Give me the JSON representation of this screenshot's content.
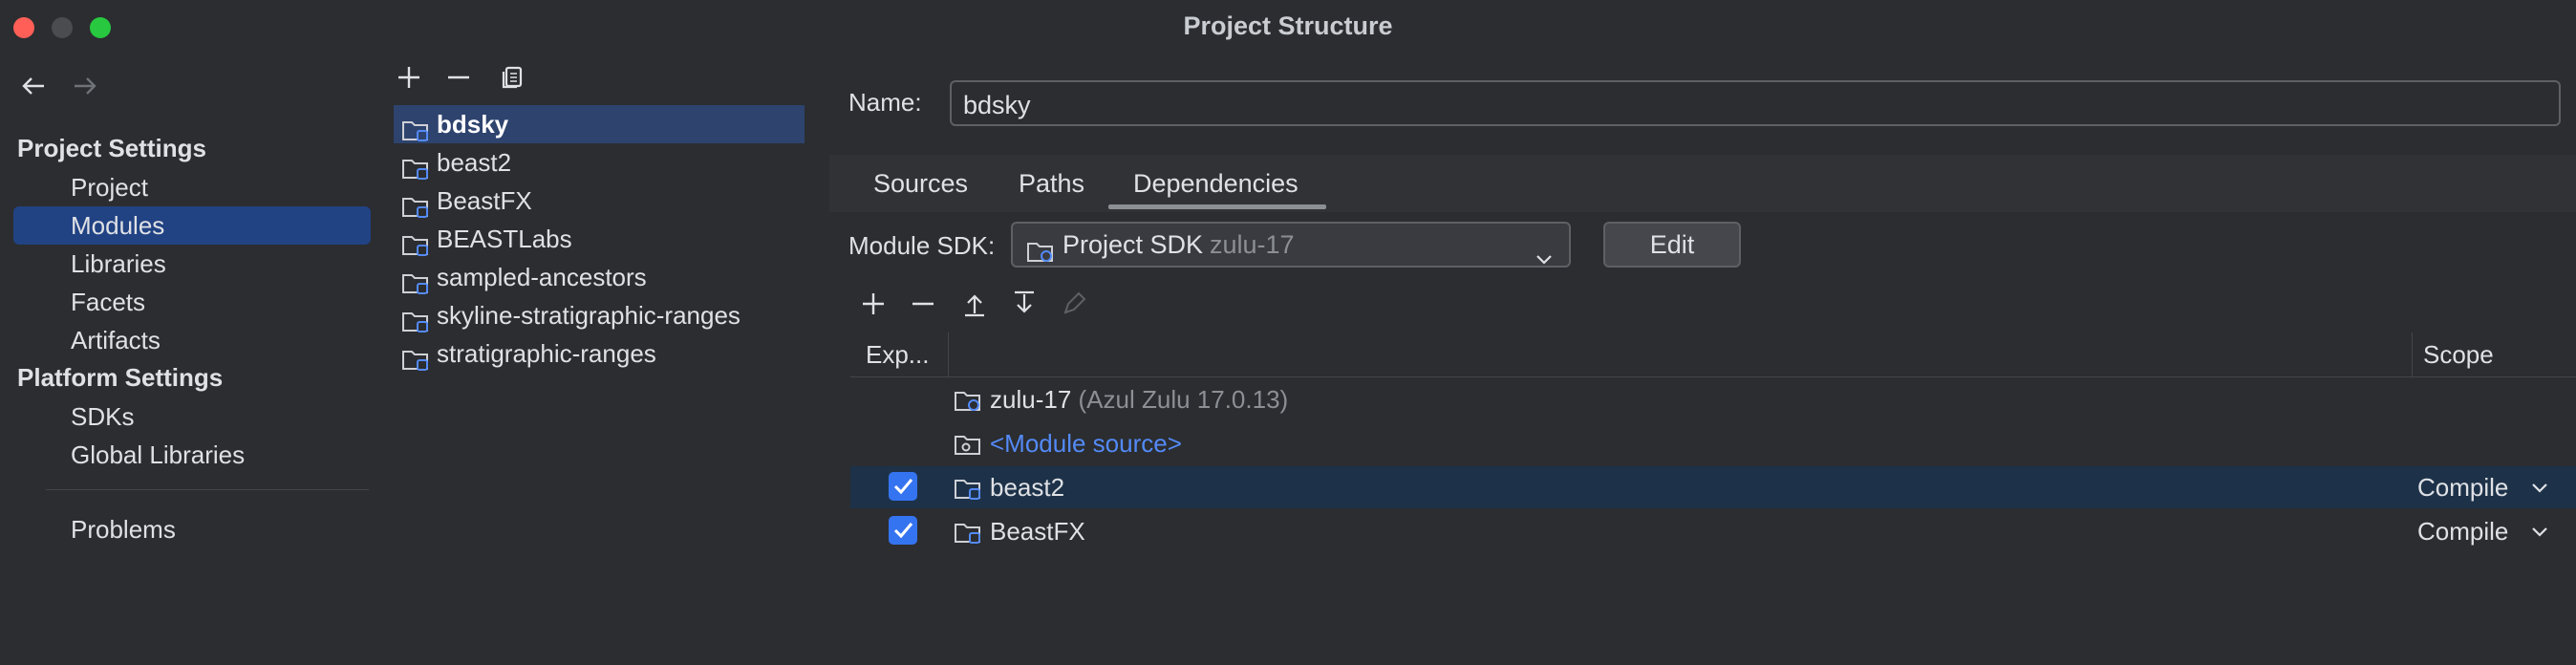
{
  "window": {
    "title": "Project Structure"
  },
  "nav": {
    "back_icon": "arrow-left-icon",
    "forward_icon": "arrow-right-icon"
  },
  "sidebar": {
    "project_settings_heading": "Project Settings",
    "project_settings_items": [
      {
        "label": "Project",
        "selected": false
      },
      {
        "label": "Modules",
        "selected": true
      },
      {
        "label": "Libraries",
        "selected": false
      },
      {
        "label": "Facets",
        "selected": false
      },
      {
        "label": "Artifacts",
        "selected": false
      }
    ],
    "platform_settings_heading": "Platform Settings",
    "platform_settings_items": [
      {
        "label": "SDKs"
      },
      {
        "label": "Global Libraries"
      }
    ],
    "problems_label": "Problems"
  },
  "module_list": {
    "toolbar": {
      "add_icon": "plus-icon",
      "remove_icon": "minus-icon",
      "copy_icon": "copy-icon"
    },
    "items": [
      {
        "label": "bdsky",
        "selected": true
      },
      {
        "label": "beast2",
        "selected": false
      },
      {
        "label": "BeastFX",
        "selected": false
      },
      {
        "label": "BEASTLabs",
        "selected": false
      },
      {
        "label": "sampled-ancestors",
        "selected": false
      },
      {
        "label": "skyline-stratigraphic-ranges",
        "selected": false
      },
      {
        "label": "stratigraphic-ranges",
        "selected": false
      }
    ]
  },
  "details": {
    "name_label": "Name:",
    "name_value": "bdsky",
    "tabs": [
      {
        "label": "Sources",
        "active": false
      },
      {
        "label": "Paths",
        "active": false
      },
      {
        "label": "Dependencies",
        "active": true
      }
    ],
    "module_sdk_label": "Module SDK:",
    "module_sdk_value": "Project SDK",
    "module_sdk_detail": "zulu-17",
    "edit_button": "Edit",
    "dep_toolbar": {
      "add_icon": "plus-icon",
      "remove_icon": "minus-icon",
      "move_up_icon": "move-up-icon",
      "move_down_icon": "move-down-icon",
      "edit_icon": "pencil-icon"
    },
    "table": {
      "col_export": "Exp...",
      "col_scope": "Scope",
      "rows": [
        {
          "name": "zulu-17",
          "detail": "(Azul Zulu 17.0.13)",
          "checked": null,
          "scope": "",
          "kind": "sdk"
        },
        {
          "name": "<Module source>",
          "detail": "",
          "checked": null,
          "scope": "",
          "kind": "source"
        },
        {
          "name": "beast2",
          "detail": "",
          "checked": true,
          "scope": "Compile",
          "kind": "module",
          "selected": true
        },
        {
          "name": "BeastFX",
          "detail": "",
          "checked": true,
          "scope": "Compile",
          "kind": "module"
        }
      ]
    }
  },
  "colors": {
    "background": "#2b2d30",
    "selection": "#214283",
    "checkbox": "#3574f0",
    "link": "#548af7"
  }
}
